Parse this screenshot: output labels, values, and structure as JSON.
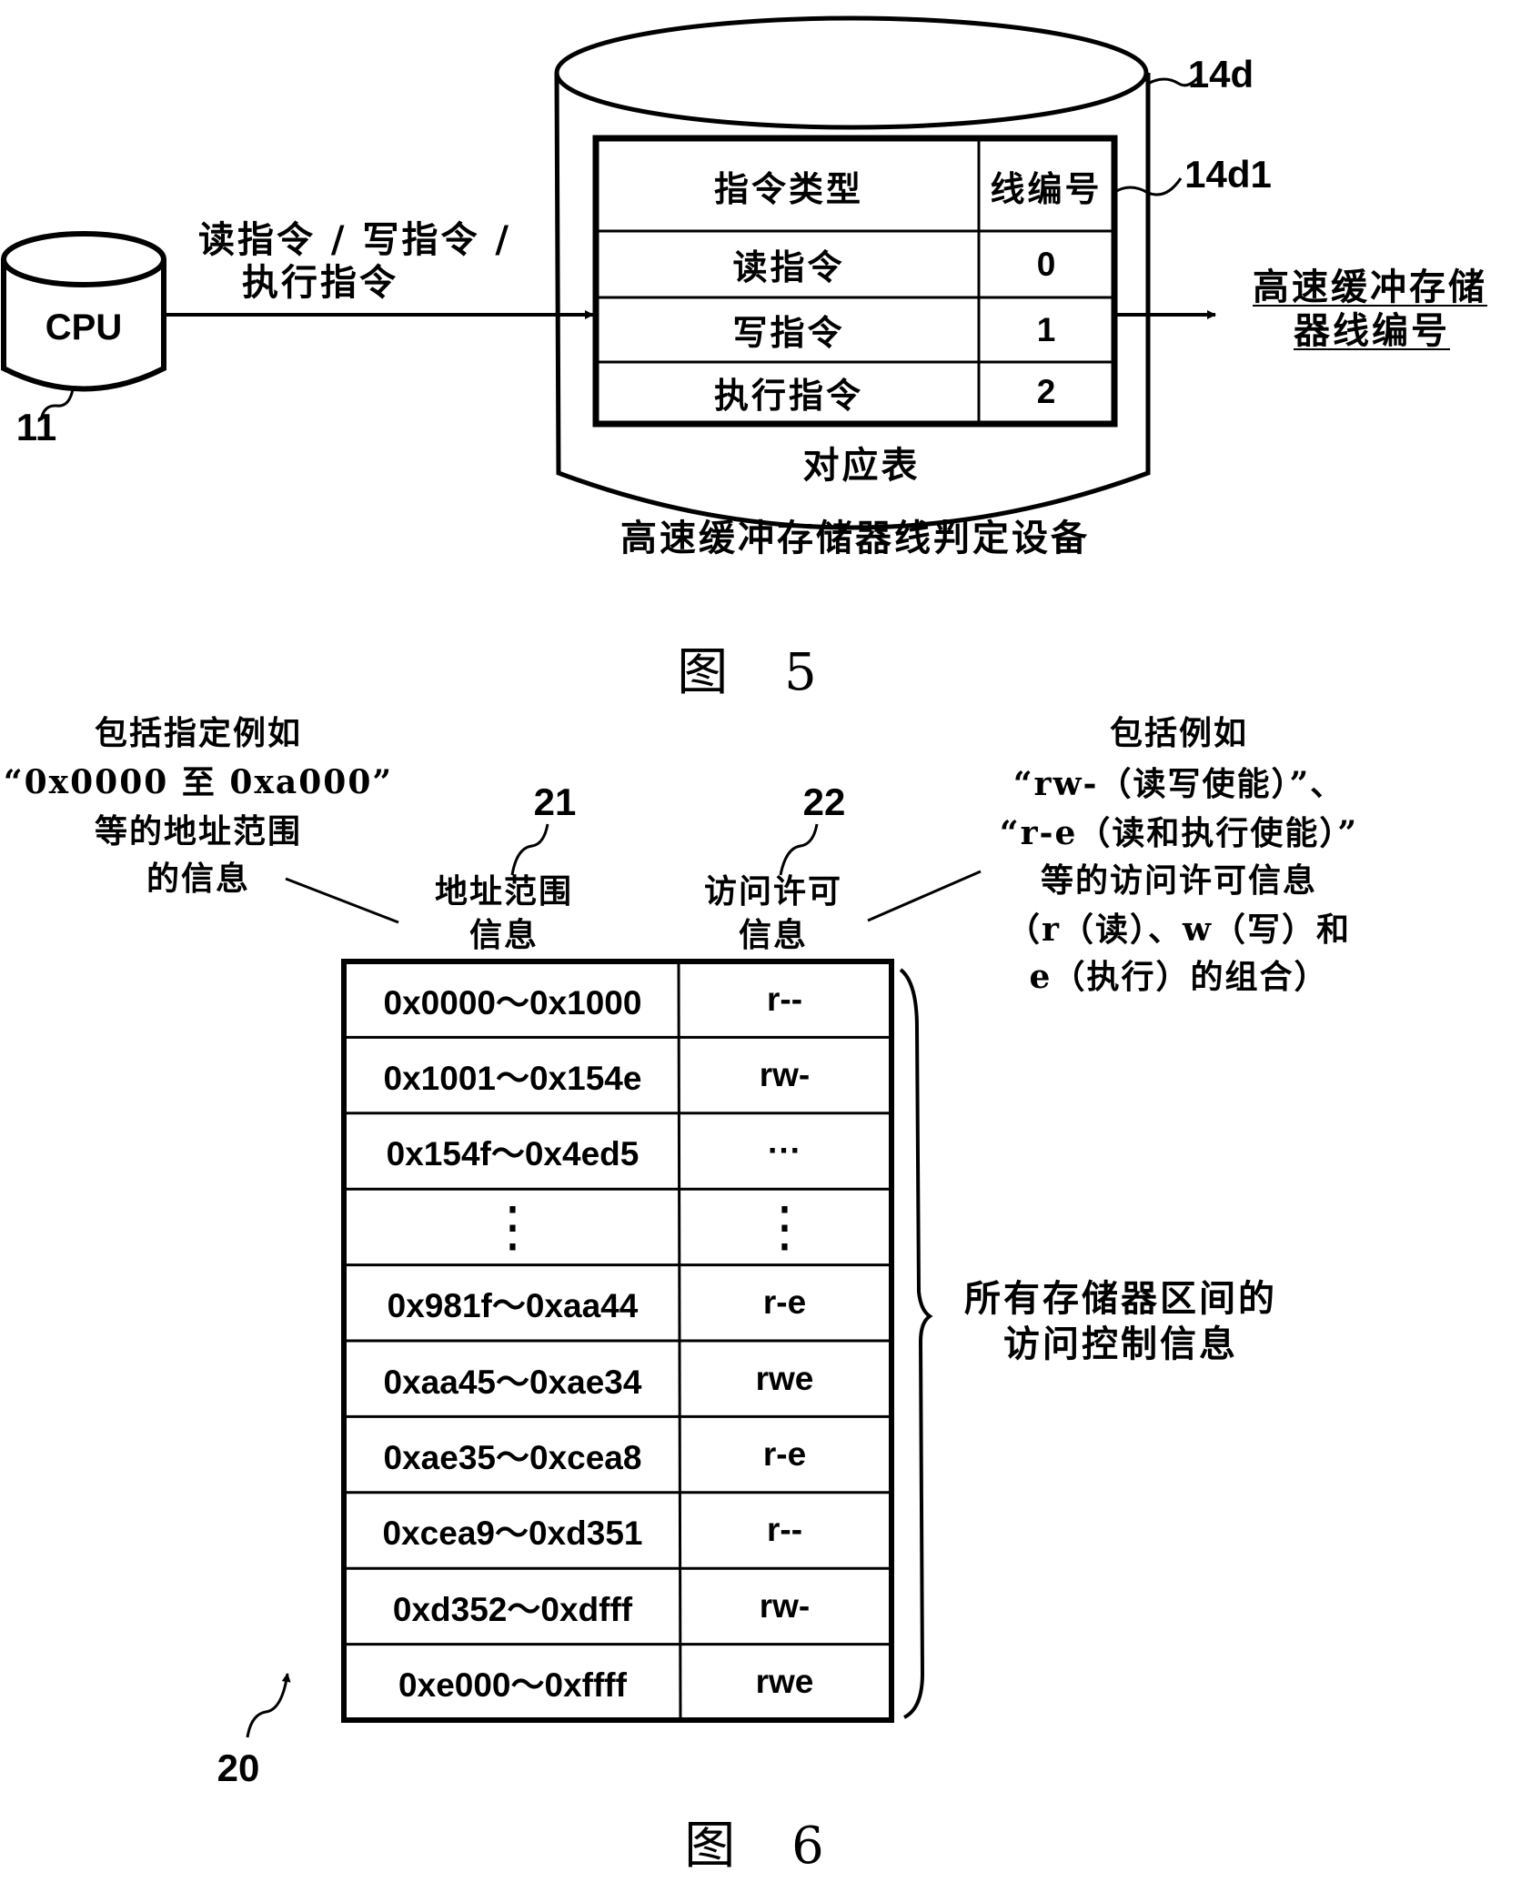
{
  "figure5": {
    "caption": "图 5",
    "cpu": {
      "label": "CPU",
      "ref": "11"
    },
    "input_label_line1": "读指令 / 写指令 /",
    "input_label_line2": "执行指令",
    "device": {
      "ref": "14d",
      "name": "高速缓冲存储器线判定设备",
      "table_caption": "对应表",
      "table_ref": "14d1",
      "columns": [
        "指令类型",
        "线编号"
      ],
      "rows": [
        {
          "instruction": "读指令",
          "line": "0"
        },
        {
          "instruction": "写指令",
          "line": "1"
        },
        {
          "instruction": "执行指令",
          "line": "2"
        }
      ]
    },
    "output_label_line1": "高速缓冲存储",
    "output_label_line2": "器线编号"
  },
  "figure6": {
    "caption": "图 6",
    "table_ref": "20",
    "left_annotation": [
      "包括指定例如",
      "“0x0000 至 0xa000”",
      "等的地址范围",
      "的信息"
    ],
    "right_annotation": [
      "包括例如",
      "“rw-（读写使能）”、",
      "“r-e（读和执行使能）”",
      "等的访问许可信息",
      "（r（读）、w（写）和",
      "e（执行）的组合）"
    ],
    "columns": [
      {
        "ref": "21",
        "label_line1": "地址范围",
        "label_line2": "信息"
      },
      {
        "ref": "22",
        "label_line1": "访问许可",
        "label_line2": "信息"
      }
    ],
    "rows": [
      {
        "range": "0x0000～0x1000",
        "perm": "r--"
      },
      {
        "range": "0x1001～0x154e",
        "perm": "rw-"
      },
      {
        "range": "0x154f～0x4ed5",
        "perm": "···"
      },
      {
        "range": "⋮",
        "perm": "⋮"
      },
      {
        "range": "0x981f～0xaa44",
        "perm": "r-e"
      },
      {
        "range": "0xaa45～0xae34",
        "perm": "rwe"
      },
      {
        "range": "0xae35～0xcea8",
        "perm": "r-e"
      },
      {
        "range": "0xcea9～0xd351",
        "perm": "r--"
      },
      {
        "range": "0xd352～0xdfff",
        "perm": "rw-"
      },
      {
        "range": "0xe000～0xffff",
        "perm": "rwe"
      }
    ],
    "brace_label_line1": "所有存储器区间的",
    "brace_label_line2": "访问控制信息"
  }
}
